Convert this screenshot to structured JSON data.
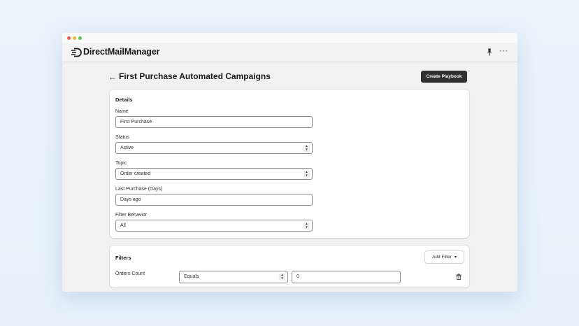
{
  "app": {
    "name": "DirectMailManager"
  },
  "header": {
    "more_label": "···"
  },
  "page": {
    "back_label": "←",
    "title": "First Purchase Automated Campaigns",
    "primary_action": "Create Playbook"
  },
  "details": {
    "title": "Details",
    "fields": [
      {
        "label": "Name",
        "value": "First Purchase",
        "kind": "text"
      },
      {
        "label": "Status",
        "value": "Active",
        "kind": "select"
      },
      {
        "label": "Topic",
        "value": "Order created",
        "kind": "select"
      },
      {
        "label": "Last Purchase (Days)",
        "value": "Days ago",
        "kind": "text"
      },
      {
        "label": "Filter Behavior",
        "value": "All",
        "kind": "select"
      }
    ]
  },
  "filters": {
    "title": "Filters",
    "add_label": "Add Filter",
    "rows": [
      {
        "label": "Orders Count",
        "operator": "Equals",
        "value": "0"
      }
    ]
  },
  "icons": {
    "arrows": "⌃⌄",
    "chevron": "⌄"
  },
  "colors": {
    "primary_button": "#303030",
    "window_bg": "#f1f1f1",
    "card_bg": "#ffffff"
  }
}
